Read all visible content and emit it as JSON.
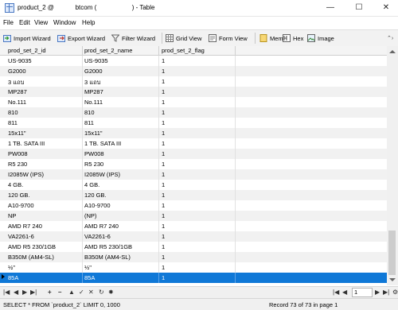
{
  "window": {
    "title": "product_2 @            btcom (                    ) - Table",
    "minimize_icon": "minimize-icon",
    "maximize_icon": "maximize-icon",
    "close_icon": "close-icon"
  },
  "menu": [
    "File",
    "Edit",
    "View",
    "Window",
    "Help"
  ],
  "toolbar": {
    "import_wizard": "Import Wizard",
    "export_wizard": "Export Wizard",
    "filter_wizard": "Filter Wizard",
    "grid_view": "Grid View",
    "form_view": "Form View",
    "memo": "Memo",
    "hex": "Hex",
    "image": "Image"
  },
  "table": {
    "columns": [
      "prod_set_2_id",
      "prod_set_2_name",
      "prod_set_2_flag"
    ],
    "rows": [
      [
        "US-9035",
        "US-9035",
        "1"
      ],
      [
        "G2000",
        "G2000",
        "1"
      ],
      [
        "3 แถบ",
        "3 แถบ",
        "1"
      ],
      [
        "MP287",
        "MP287",
        "1"
      ],
      [
        "No.111",
        "No.111",
        "1"
      ],
      [
        "810",
        "810",
        "1"
      ],
      [
        "811",
        "811",
        "1"
      ],
      [
        "15x11\"",
        "15x11\"",
        "1"
      ],
      [
        "1 TB. SATA III",
        "1 TB. SATA III",
        "1"
      ],
      [
        "PW008",
        "PW008",
        "1"
      ],
      [
        "R5 230",
        "R5 230",
        "1"
      ],
      [
        "I2085W (IPS)",
        "I2085W (IPS)",
        "1"
      ],
      [
        "4 GB.",
        "4 GB.",
        "1"
      ],
      [
        "120 GB.",
        "120 GB.",
        "1"
      ],
      [
        "A10-9700",
        "A10-9700",
        "1"
      ],
      [
        "NP",
        "(NP)",
        "1"
      ],
      [
        "AMD R7 240",
        "AMD R7 240",
        "1"
      ],
      [
        "VA2261-6",
        "VA2261-6",
        "1"
      ],
      [
        "AMD R5 230/1GB",
        "AMD R5 230/1GB",
        "1"
      ],
      [
        "B350M (AM4-SL)",
        "B350M (AM4-SL)",
        "1"
      ],
      [
        "½\"",
        "½\"",
        "1"
      ],
      [
        "85A",
        "85A",
        "1"
      ]
    ],
    "selected_row_index": 21
  },
  "navigation": {
    "page": "1"
  },
  "status": {
    "sql": "SELECT * FROM `product_2` LIMIT 0, 1000",
    "record": "Record 73 of 73 in page 1"
  }
}
